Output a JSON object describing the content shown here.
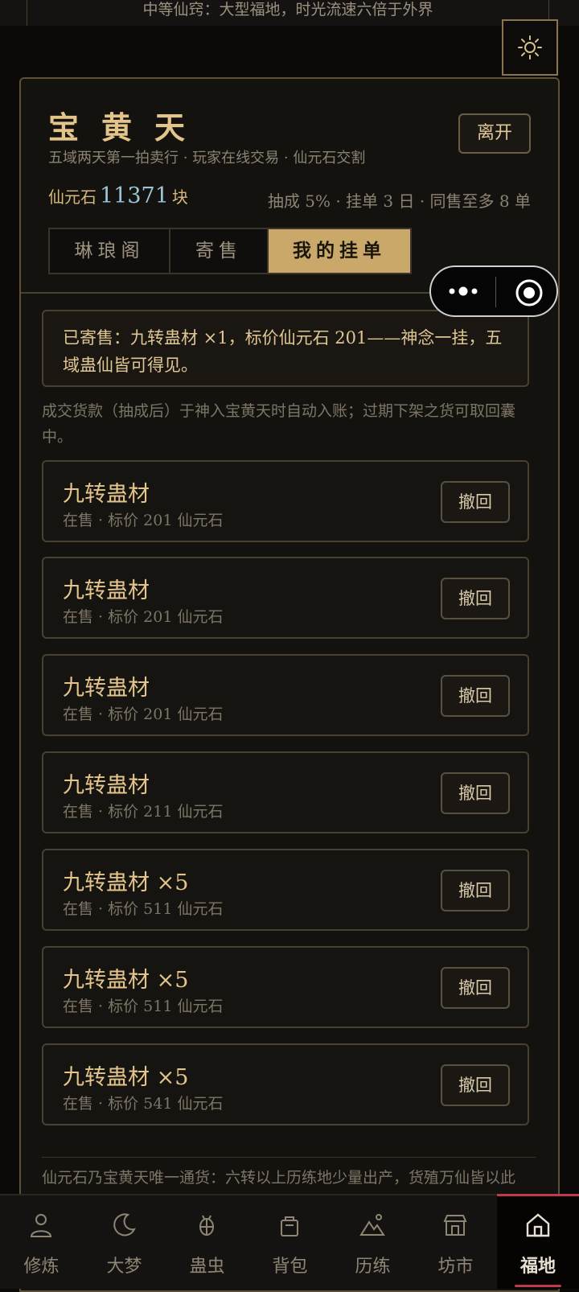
{
  "top_banner": "中等仙窍：大型福地，时光流速六倍于外界",
  "icons": {
    "settings": "sun-gear-icon",
    "menu": "more-dots-icon",
    "close": "target-circle-icon"
  },
  "header": {
    "title": "宝黄天",
    "leave_label": "离开",
    "subtitle": "五域两天第一拍卖行 · 玩家在线交易 · 仙元石交割",
    "currency_label": "仙元石",
    "currency_amount": "11371",
    "currency_unit": "块",
    "rules": "抽成 5% · 挂单 3 日 · 同售至多 8 单"
  },
  "tabs": [
    {
      "label": "琳琅阁",
      "active": false
    },
    {
      "label": "寄售",
      "active": false
    },
    {
      "label": "我的挂单",
      "active": true
    }
  ],
  "notice": "已寄售：九转蛊材 ×1，标价仙元石 201——神念一挂，五域蛊仙皆可得见。",
  "hint": "成交货款（抽成后）于神入宝黄天时自动入账；过期下架之货可取回囊中。",
  "listings": [
    {
      "name": "九转蛊材",
      "meta": "在售 · 标价 201 仙元石",
      "action": "撤回"
    },
    {
      "name": "九转蛊材",
      "meta": "在售 · 标价 201 仙元石",
      "action": "撤回"
    },
    {
      "name": "九转蛊材",
      "meta": "在售 · 标价 201 仙元石",
      "action": "撤回"
    },
    {
      "name": "九转蛊材",
      "meta": "在售 · 标价 211 仙元石",
      "action": "撤回"
    },
    {
      "name": "九转蛊材 ×5",
      "meta": "在售 · 标价 511 仙元石",
      "action": "撤回"
    },
    {
      "name": "九转蛊材 ×5",
      "meta": "在售 · 标价 511 仙元石",
      "action": "撤回"
    },
    {
      "name": "九转蛊材 ×5",
      "meta": "在售 · 标价 541 仙元石",
      "action": "撤回"
    }
  ],
  "footer_note": "仙元石乃宝黄天唯一通货：六转以上历练地少量出产，货殖万仙皆以此",
  "nav": [
    {
      "label": "修炼",
      "icon": "person-icon",
      "active": false
    },
    {
      "label": "大梦",
      "icon": "moon-icon",
      "active": false
    },
    {
      "label": "蛊虫",
      "icon": "bug-icon",
      "active": false
    },
    {
      "label": "背包",
      "icon": "bag-icon",
      "active": false
    },
    {
      "label": "历练",
      "icon": "mountain-icon",
      "active": false
    },
    {
      "label": "坊市",
      "icon": "shop-icon",
      "active": false
    },
    {
      "label": "福地",
      "icon": "home-icon",
      "active": true
    }
  ],
  "colors": {
    "accent": "#c9a86a",
    "active_nav": "#c0394e",
    "currency_value": "#9ac6d8"
  }
}
